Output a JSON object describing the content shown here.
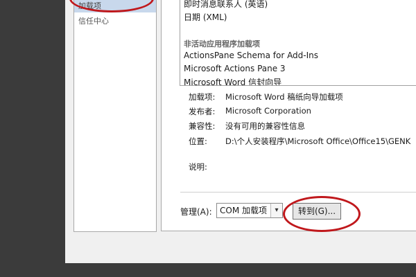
{
  "sidebar": {
    "items": [
      {
        "label": "加载项",
        "selected": true
      },
      {
        "label": "信任中心",
        "selected": false
      }
    ]
  },
  "addin_list": {
    "lines": [
      {
        "text": "即时消息联系人 (英语)",
        "kind": "item"
      },
      {
        "text": "日期 (XML)",
        "kind": "item"
      },
      {
        "text": "非活动应用程序加载项",
        "kind": "header"
      },
      {
        "text": "ActionsPane Schema for Add-Ins",
        "kind": "item"
      },
      {
        "text": "Microsoft Actions Pane 3",
        "kind": "item"
      },
      {
        "text": "Microsoft Word 信封向导",
        "kind": "item"
      }
    ]
  },
  "details": {
    "addin_label": "加载项:",
    "addin_value": "Microsoft Word 稿纸向导加载项",
    "publisher_label": "发布者:",
    "publisher_value": "Microsoft Corporation",
    "compat_label": "兼容性:",
    "compat_value": "没有可用的兼容性信息",
    "location_label": "位置:",
    "location_value": "D:\\个人安装程序\\Microsoft Office\\Office15\\GENK",
    "desc_label": "说明:"
  },
  "manage": {
    "label": "管理(A):",
    "selected_value": "COM 加载项",
    "go_button": "转到(G)..."
  },
  "colors": {
    "background": "#3b3b3b",
    "dialog": "#f0f0f0",
    "selected_item": "#c8d8ec",
    "annotation": "#c0181c"
  }
}
